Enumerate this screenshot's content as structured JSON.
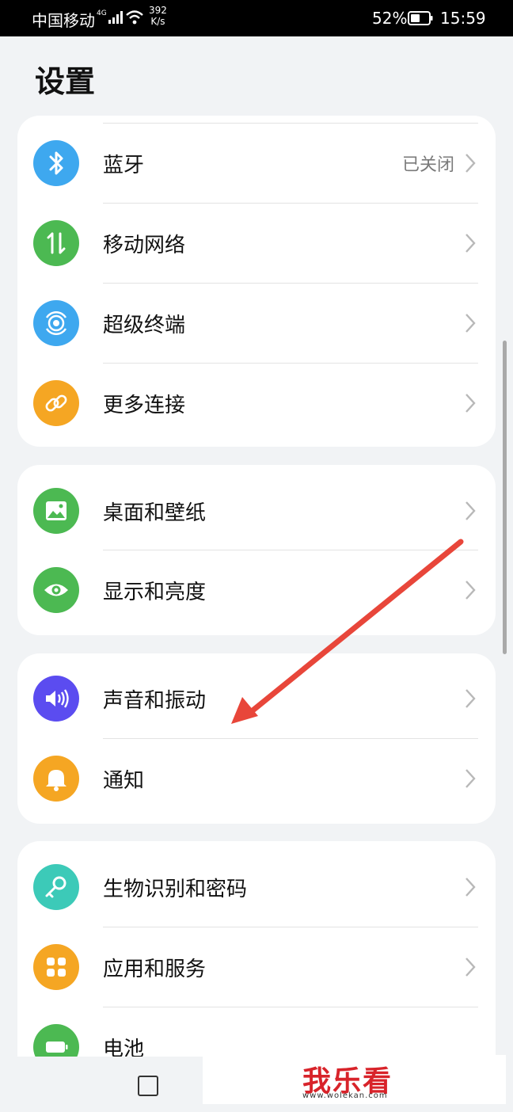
{
  "status_bar": {
    "carrier": "中国移动",
    "network": "4G",
    "speed_value": "392",
    "speed_unit": "K/s",
    "battery_percent": "52%",
    "time": "15:59"
  },
  "page_title": "设置",
  "groups": [
    {
      "items": [
        {
          "label": "蓝牙",
          "value": "已关闭",
          "icon": "bluetooth-icon",
          "color": "#3ea8ef"
        },
        {
          "label": "移动网络",
          "value": "",
          "icon": "mobile-data-icon",
          "color": "#4cb952"
        },
        {
          "label": "超级终端",
          "value": "",
          "icon": "super-device-icon",
          "color": "#3ea8ef"
        },
        {
          "label": "更多连接",
          "value": "",
          "icon": "link-icon",
          "color": "#f5a623"
        }
      ]
    },
    {
      "items": [
        {
          "label": "桌面和壁纸",
          "value": "",
          "icon": "wallpaper-icon",
          "color": "#4cb952"
        },
        {
          "label": "显示和亮度",
          "value": "",
          "icon": "eye-icon",
          "color": "#4cb952"
        }
      ]
    },
    {
      "items": [
        {
          "label": "声音和振动",
          "value": "",
          "icon": "speaker-icon",
          "color": "#5b4cf0"
        },
        {
          "label": "通知",
          "value": "",
          "icon": "bell-icon",
          "color": "#f5a623"
        }
      ]
    },
    {
      "items": [
        {
          "label": "生物识别和密码",
          "value": "",
          "icon": "key-icon",
          "color": "#3ccab8"
        },
        {
          "label": "应用和服务",
          "value": "",
          "icon": "apps-icon",
          "color": "#f5a623"
        },
        {
          "label": "电池",
          "value": "",
          "icon": "battery-icon",
          "color": "#4cb952"
        }
      ]
    }
  ],
  "watermark": {
    "logo": "我乐看",
    "url": "www.wolekan.com"
  }
}
